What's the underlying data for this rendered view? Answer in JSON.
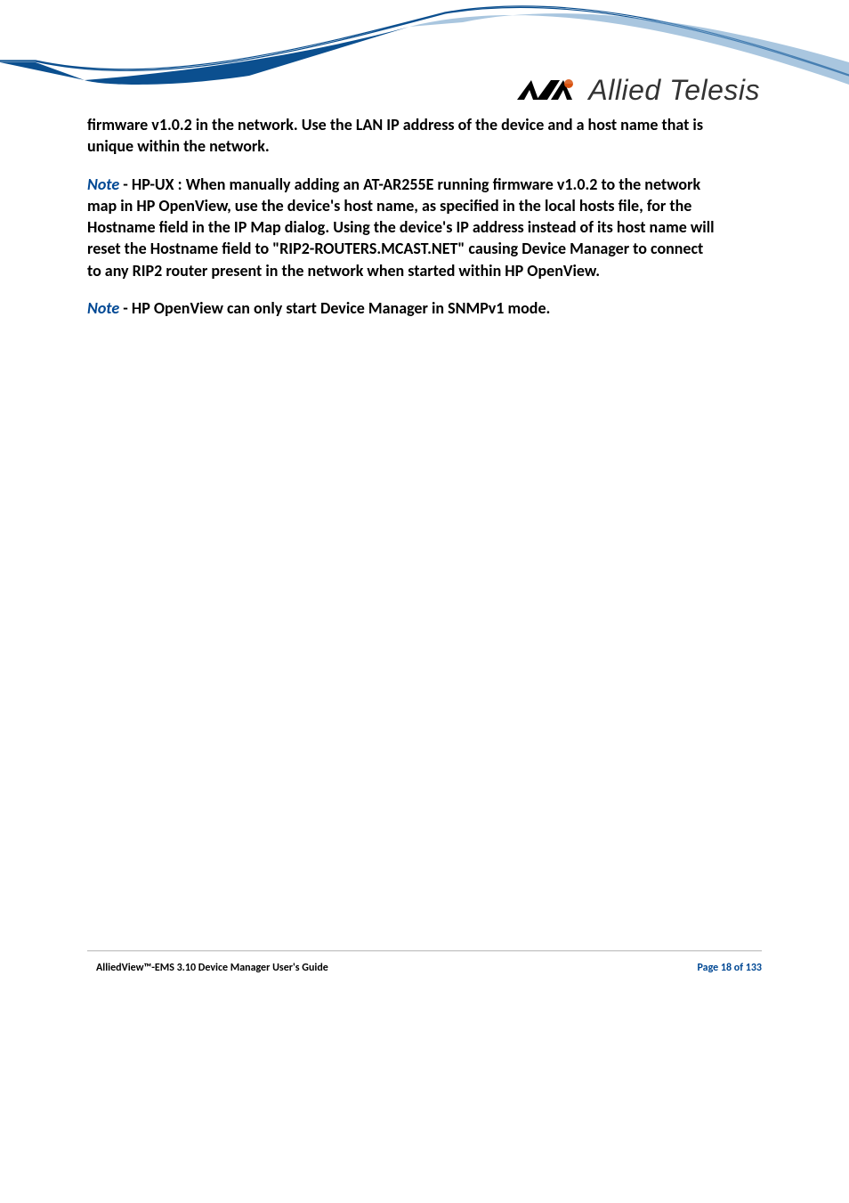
{
  "brand": {
    "name": "Allied Telesis"
  },
  "content": {
    "p1": "firmware v1.0.2 in the network.  Use the LAN IP address of the device and a host name that is unique within the network.",
    "note2_label": "Note",
    "p2": " - HP-UX : When manually adding an AT-AR255E running firmware v1.0.2 to the network map in HP OpenView, use the device's host name, as specified in the local hosts file, for the Hostname field in the IP Map dialog. Using the device's IP address instead of its host name will reset the Hostname field to \"RIP2-ROUTERS.MCAST.NET\" causing Device Manager to connect to any RIP2 router present in the network when started within HP OpenView.",
    "note3_label": "Note",
    "p3": " - HP OpenView can only start Device Manager in SNMPv1 mode."
  },
  "footer": {
    "left": "AlliedView™-EMS 3.10 Device Manager User's Guide",
    "right": "Page 18 of 133"
  }
}
